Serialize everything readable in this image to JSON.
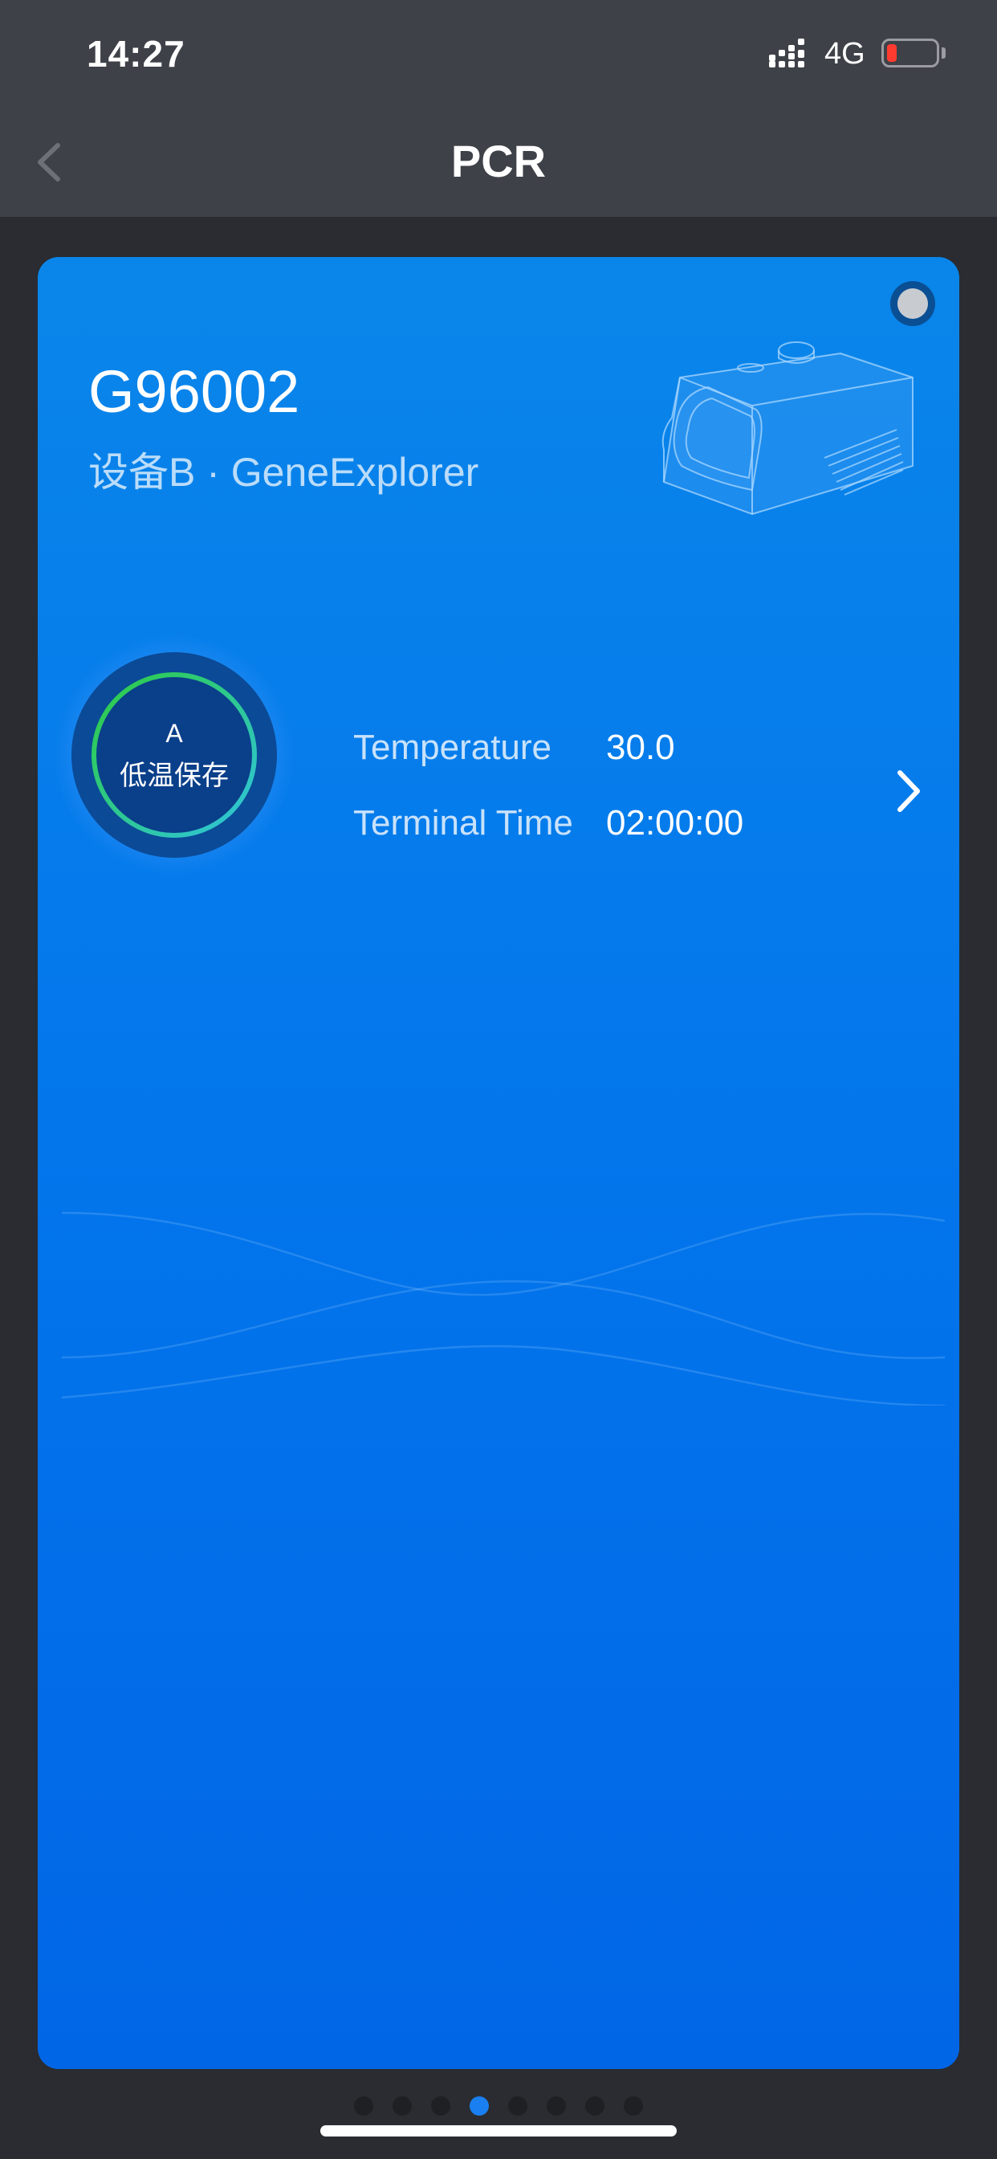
{
  "status_bar": {
    "time": "14:27",
    "network": "4G",
    "battery_level": 0.1,
    "battery_color": "#ff3b30"
  },
  "nav": {
    "title": "PCR",
    "back_icon": "chevron-left-icon"
  },
  "card": {
    "device_id": "G96002",
    "device_subtitle": "设备B · GeneExplorer",
    "status_indicator_color": "#c8cbd0",
    "channel": {
      "letter": "A",
      "mode": "低温保存"
    },
    "info": {
      "temperature_label": "Temperature",
      "temperature_value": "30.0",
      "terminal_time_label": "Terminal Time",
      "terminal_time_value": "02:00:00"
    },
    "detail_icon": "chevron-right-icon"
  },
  "pager": {
    "total": 8,
    "active_index": 3
  },
  "colors": {
    "card_top": "#0a86ea",
    "card_bottom": "#0166e6",
    "header_bg": "#3e4147",
    "page_bg": "#2a2c31",
    "ring_start": "#2ecc40",
    "ring_end": "#2fc4e0"
  }
}
